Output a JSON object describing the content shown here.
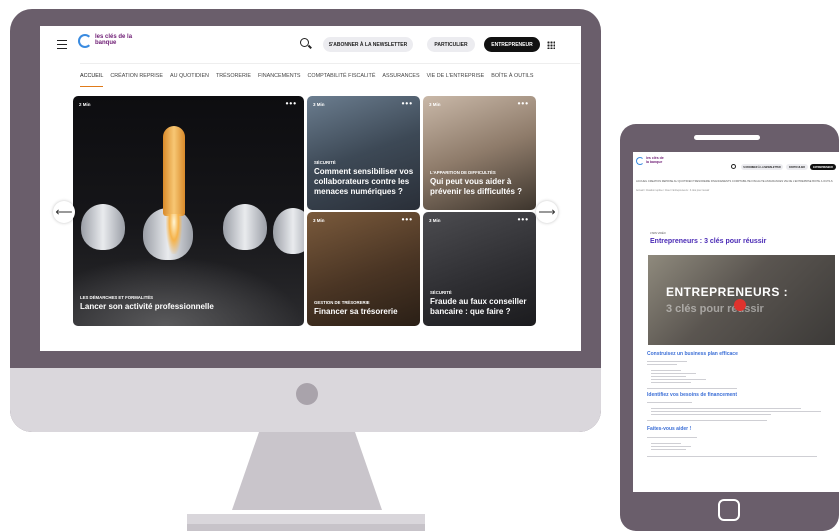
{
  "desktop": {
    "logo_text": "les clés de la banque",
    "newsletter_label": "S'ABONNER À LA NEWSLETTER",
    "particulier_label": "PARTICULIER",
    "entrepreneur_label": "ENTREPRENEUR",
    "nav": [
      "ACCUEIL",
      "CRÉATION REPRISE",
      "AU QUOTIDIEN",
      "TRÉSORERIE",
      "FINANCEMENTS",
      "COMPTABILITÉ FISCALITÉ",
      "ASSURANCES",
      "VIE DE L'ENTREPRISE",
      "BOÎTE À OUTILS"
    ],
    "cards": {
      "main": {
        "time": "2 Min",
        "category": "LES DÉMARCHES ET FORMALITÉS",
        "title": "Lancer son activité professionnelle"
      },
      "a": {
        "time": "3 Min",
        "category": "SÉCURITÉ",
        "title": "Comment sensibiliser vos collaborateurs contre les menaces numériques ?"
      },
      "b": {
        "time": "3 Min",
        "category": "L'APPARITION DE DIFFICULTÉS",
        "title": "Qui peut vous aider à prévenir les difficultés ?"
      },
      "c": {
        "time": "3 Min",
        "category": "GESTION DE TRÉSORERIE",
        "title": "Financer sa trésorerie"
      },
      "d": {
        "time": "3 Min",
        "category": "SÉCURITÉ",
        "title": "Fraude au faux conseiller bancaire : que faire ?"
      }
    },
    "dots": "•••",
    "prev_arrow": "⟵",
    "next_arrow": "⟶"
  },
  "phone": {
    "logo_text": "les clés de la banque",
    "newsletter_label": "S'ABONNER À LA NEWSLETTER",
    "particulier_label": "PARTICULIER",
    "entrepreneur_label": "ENTREPRENEUR",
    "nav_text": "ACCUEIL   CRÉATION REPRISE   AU QUOTIDIEN   TRÉSORERIE   FINANCEMENTS   COMPTABILITÉ FISCALITÉ   ASSURANCES   VIE DE L'ENTREPRISE   BOÎTE À OUTILS",
    "breadcrumb": "Accueil / Création reprise / Créer / Entrepreneurs : 3 clés pour réussir",
    "meta": "3 MIN    VIDÉO",
    "article_title": "Entrepreneurs : 3 clés pour réussir",
    "video_headline": "ENTREPRENEURS :",
    "video_subline": "3 clés pour réussir",
    "section_1": "Construisez un business plan efficace",
    "section_2": "Identifiez vos besoins de financement",
    "section_3": "Faites-vous aider !"
  },
  "colors": {
    "frame": "#6a5e6b",
    "accent_purple": "#4a2ab5",
    "accent_blue": "#3b6ed6",
    "nav_underline": "#e07b1a"
  }
}
